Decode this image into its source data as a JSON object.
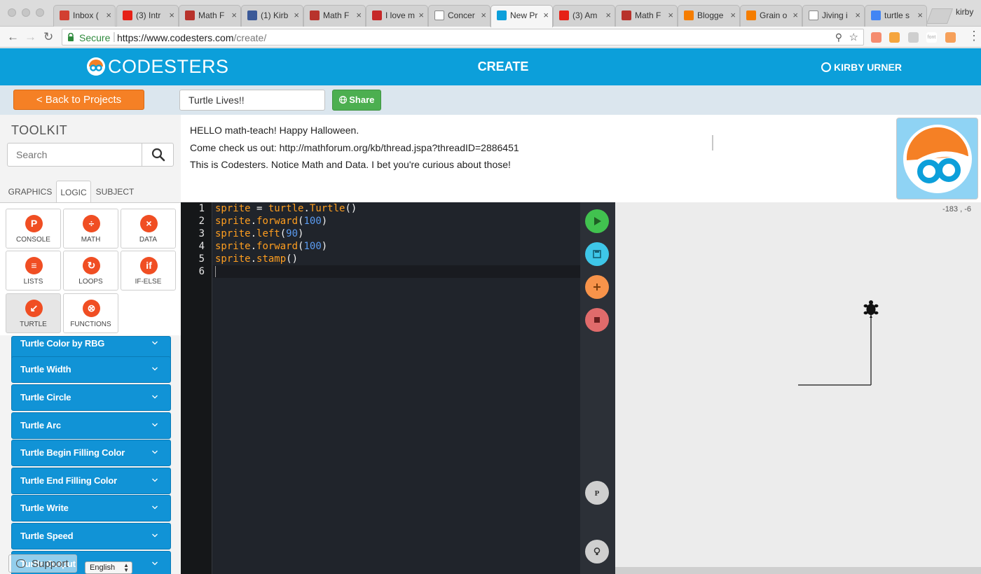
{
  "browser": {
    "tabs": [
      {
        "label": "Inbox (",
        "favicon": "gmail-icon",
        "color": "#d23f31"
      },
      {
        "label": "(3) Intr",
        "favicon": "youtube-icon",
        "color": "#e62117"
      },
      {
        "label": "Math F",
        "favicon": "star-of-david-icon",
        "color": "#b8332c"
      },
      {
        "label": "(1) Kirb",
        "favicon": "facebook-icon",
        "color": "#3b5998"
      },
      {
        "label": "Math F",
        "favicon": "star-of-david-icon",
        "color": "#b8332c"
      },
      {
        "label": "I love m",
        "favicon": "maple-leaf-icon",
        "color": "#c62828"
      },
      {
        "label": "Concer",
        "favicon": "document-icon",
        "color": "#ffffff"
      },
      {
        "label": "New Pr",
        "favicon": "codesters-icon",
        "color": "#0c9fda",
        "active": true
      },
      {
        "label": "(3) Am",
        "favicon": "youtube-icon",
        "color": "#e62117"
      },
      {
        "label": "Math F",
        "favicon": "star-of-david-icon",
        "color": "#b8332c"
      },
      {
        "label": "Blogge",
        "favicon": "blogger-icon",
        "color": "#f57d00"
      },
      {
        "label": "Grain o",
        "favicon": "blogger-icon",
        "color": "#f57d00"
      },
      {
        "label": "Jiving i",
        "favicon": "document-icon",
        "color": "#ffffff"
      },
      {
        "label": "turtle s",
        "favicon": "google-icon",
        "color": "#4285f4"
      }
    ],
    "profile_name": "kirby",
    "url_secure_label": "Secure",
    "url_scheme_host": "https://www.codesters.com",
    "url_path": "/create/",
    "extensions": [
      {
        "name": "plus-extension-icon",
        "color": "#f58c6f"
      },
      {
        "name": "blogger-extension-icon",
        "color": "#f5a53d"
      },
      {
        "name": "drive-extension-icon",
        "color": "#cfcfcf"
      },
      {
        "name": "font-extension-icon",
        "color": "#ffffff",
        "label": "font"
      },
      {
        "name": "profile-extension-icon",
        "color": "#f6a05a"
      }
    ]
  },
  "header": {
    "brand": "CODESTERS",
    "title": "CREATE",
    "user": "KIRBY URNER",
    "brand_color": "#0c9fda"
  },
  "project": {
    "back_label": "< Back to Projects",
    "title_value": "Turtle Lives!!",
    "share_label": "Share"
  },
  "toolkit": {
    "title": "TOOLKIT",
    "search_placeholder": "Search",
    "tabs": [
      "GRAPHICS",
      "LOGIC",
      "SUBJECT"
    ],
    "active_tab": "LOGIC",
    "tiles": [
      {
        "label": "CONSOLE",
        "icon": "console-icon",
        "color": "#f04e23"
      },
      {
        "label": "MATH",
        "icon": "math-icon",
        "color": "#f04e23"
      },
      {
        "label": "DATA",
        "icon": "data-icon",
        "color": "#f04e23"
      },
      {
        "label": "LISTS",
        "icon": "list-icon",
        "color": "#f04e23"
      },
      {
        "label": "LOOPS",
        "icon": "loop-icon",
        "color": "#f04e23"
      },
      {
        "label": "IF-ELSE",
        "icon": "if-else-icon",
        "color": "#f04e23"
      },
      {
        "label": "TURTLE",
        "icon": "turtle-icon",
        "color": "#f04e23",
        "active": true
      },
      {
        "label": "FUNCTIONS",
        "icon": "functions-icon",
        "color": "#f04e23"
      }
    ],
    "accordion": [
      "Turtle Color by RBG",
      "Turtle Width",
      "Turtle Circle",
      "Turtle Arc",
      "Turtle Begin Filling Color",
      "Turtle End Filling Color",
      "Turtle Write",
      "Turtle Speed",
      "Turtle Output"
    ],
    "support_label": "Support",
    "language": "English"
  },
  "description": {
    "lines": [
      "HELLO math-teach!  Happy Halloween.",
      "Come check us out:  http://mathforum.org/kb/thread.jspa?threadID=2886451",
      "This is Codesters.  Notice Math and Data.  I bet you're curious about those!"
    ]
  },
  "editor": {
    "lines": [
      {
        "n": "1",
        "tokens": [
          {
            "t": "sprite",
            "c": "id"
          },
          {
            "t": " = ",
            "c": "p"
          },
          {
            "t": "turtle",
            "c": "id"
          },
          {
            "t": ".",
            "c": "p"
          },
          {
            "t": "Turtle",
            "c": "id"
          },
          {
            "t": "()",
            "c": "p"
          }
        ]
      },
      {
        "n": "2",
        "tokens": [
          {
            "t": "sprite",
            "c": "id"
          },
          {
            "t": ".",
            "c": "p"
          },
          {
            "t": "forward",
            "c": "id"
          },
          {
            "t": "(",
            "c": "p"
          },
          {
            "t": "100",
            "c": "num"
          },
          {
            "t": ")",
            "c": "p"
          }
        ]
      },
      {
        "n": "3",
        "tokens": [
          {
            "t": "sprite",
            "c": "id"
          },
          {
            "t": ".",
            "c": "p"
          },
          {
            "t": "left",
            "c": "id"
          },
          {
            "t": "(",
            "c": "p"
          },
          {
            "t": "90",
            "c": "num"
          },
          {
            "t": ")",
            "c": "p"
          }
        ]
      },
      {
        "n": "4",
        "tokens": [
          {
            "t": "sprite",
            "c": "id"
          },
          {
            "t": ".",
            "c": "p"
          },
          {
            "t": "forward",
            "c": "id"
          },
          {
            "t": "(",
            "c": "p"
          },
          {
            "t": "100",
            "c": "num"
          },
          {
            "t": ")",
            "c": "p"
          }
        ]
      },
      {
        "n": "5",
        "tokens": [
          {
            "t": "sprite",
            "c": "id"
          },
          {
            "t": ".",
            "c": "p"
          },
          {
            "t": "stamp",
            "c": "id"
          },
          {
            "t": "()",
            "c": "p"
          }
        ]
      },
      {
        "n": "6",
        "tokens": []
      }
    ]
  },
  "controls": [
    {
      "name": "run-button",
      "icon": "play-icon",
      "color": "#41c24f"
    },
    {
      "name": "save-button",
      "icon": "save-icon",
      "color": "#3ec6e8"
    },
    {
      "name": "add-button",
      "icon": "plus-icon",
      "color": "#f7934a"
    },
    {
      "name": "stop-button",
      "icon": "stop-icon",
      "color": "#e06b6b"
    },
    {
      "name": "console-toggle-button",
      "icon": "p-icon",
      "color": "#cfcfcf",
      "glyph": "P"
    },
    {
      "name": "hint-button",
      "icon": "lightbulb-icon",
      "color": "#cfcfcf"
    }
  ],
  "stage": {
    "coords_readout": "-183 ,  -6"
  }
}
